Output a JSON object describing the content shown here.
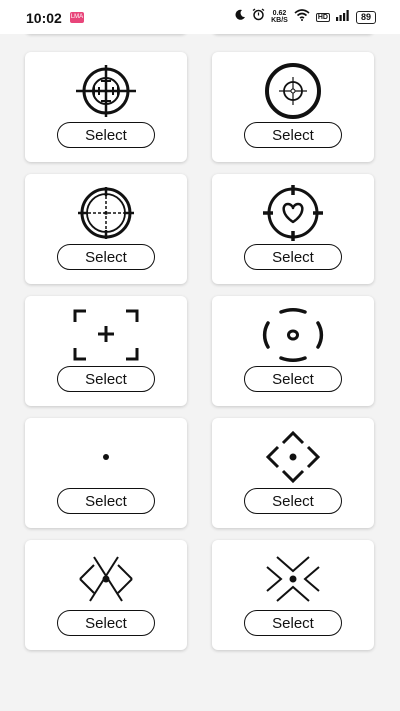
{
  "status_bar": {
    "time": "10:02",
    "notification_badge": "LMA",
    "net_speed_value": "0.62",
    "net_speed_unit": "KB/S",
    "network_label": "HD",
    "battery": "89"
  },
  "crosshairs": [
    {
      "icon": "crosshair-scope-icon",
      "select_label": "Select"
    },
    {
      "icon": "crosshair-ring-dot-icon",
      "select_label": "Select"
    },
    {
      "icon": "crosshair-dashed-scope-icon",
      "select_label": "Select"
    },
    {
      "icon": "crosshair-heart-icon",
      "select_label": "Select"
    },
    {
      "icon": "crosshair-corner-brackets-icon",
      "select_label": "Select"
    },
    {
      "icon": "crosshair-broken-circle-icon",
      "select_label": "Select"
    },
    {
      "icon": "crosshair-dot-icon",
      "select_label": "Select"
    },
    {
      "icon": "crosshair-diamond-arrows-icon",
      "select_label": "Select"
    },
    {
      "icon": "crosshair-x-lines-icon",
      "select_label": "Select"
    },
    {
      "icon": "crosshair-chevrons-icon",
      "select_label": "Select"
    }
  ],
  "colors": {
    "background": "#f3f3f3",
    "card": "#ffffff",
    "ink": "#111111"
  }
}
